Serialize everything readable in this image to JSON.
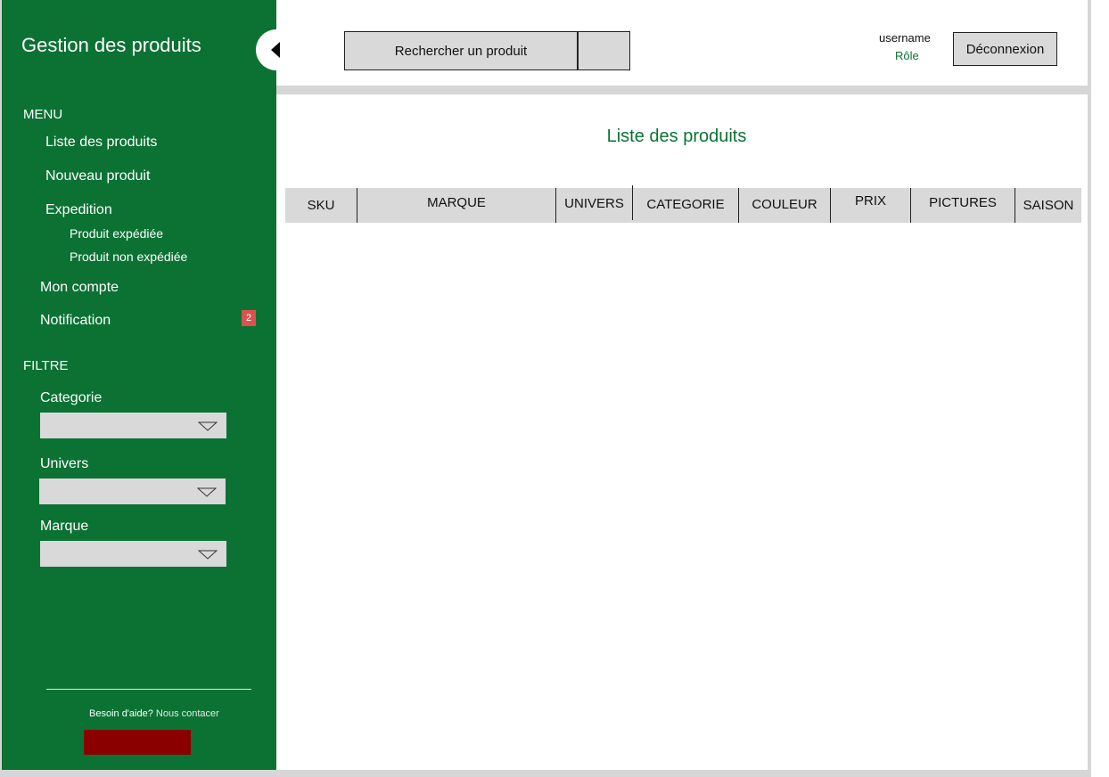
{
  "sidebar": {
    "title": "Gestion des produits",
    "menu_label": "MENU",
    "items": [
      {
        "label": "Liste des produits"
      },
      {
        "label": "Nouveau produit"
      },
      {
        "label": "Expedition"
      },
      {
        "label": "Produit expédiée"
      },
      {
        "label": "Produit non expédiée"
      },
      {
        "label": "Mon compte"
      },
      {
        "label": "Notification"
      }
    ],
    "notification_count": "2",
    "filter_label": "FILTRE",
    "filters": [
      {
        "label": "Categorie",
        "value": ""
      },
      {
        "label": "Univers",
        "value": ""
      },
      {
        "label": "Marque",
        "value": ""
      }
    ],
    "help_text": "Besoin d'aide?",
    "help_link": "Nous contacer"
  },
  "header": {
    "search_label": "Rechercher un produit",
    "username": "username",
    "role": "Rôle",
    "logout_label": "Déconnexion"
  },
  "main": {
    "title": "Liste des produits",
    "columns": [
      "SKU",
      "MARQUE",
      "UNIVERS",
      "CATEGORIE",
      "COULEUR",
      "PRIX",
      "PICTURES",
      "SAISON"
    ]
  },
  "colors": {
    "sidebar_bg": "#0b7233",
    "accent_green": "#0b7233",
    "badge_red": "#d9534f",
    "help_button": "#8a0000",
    "control_gray": "#d9d9d9"
  }
}
